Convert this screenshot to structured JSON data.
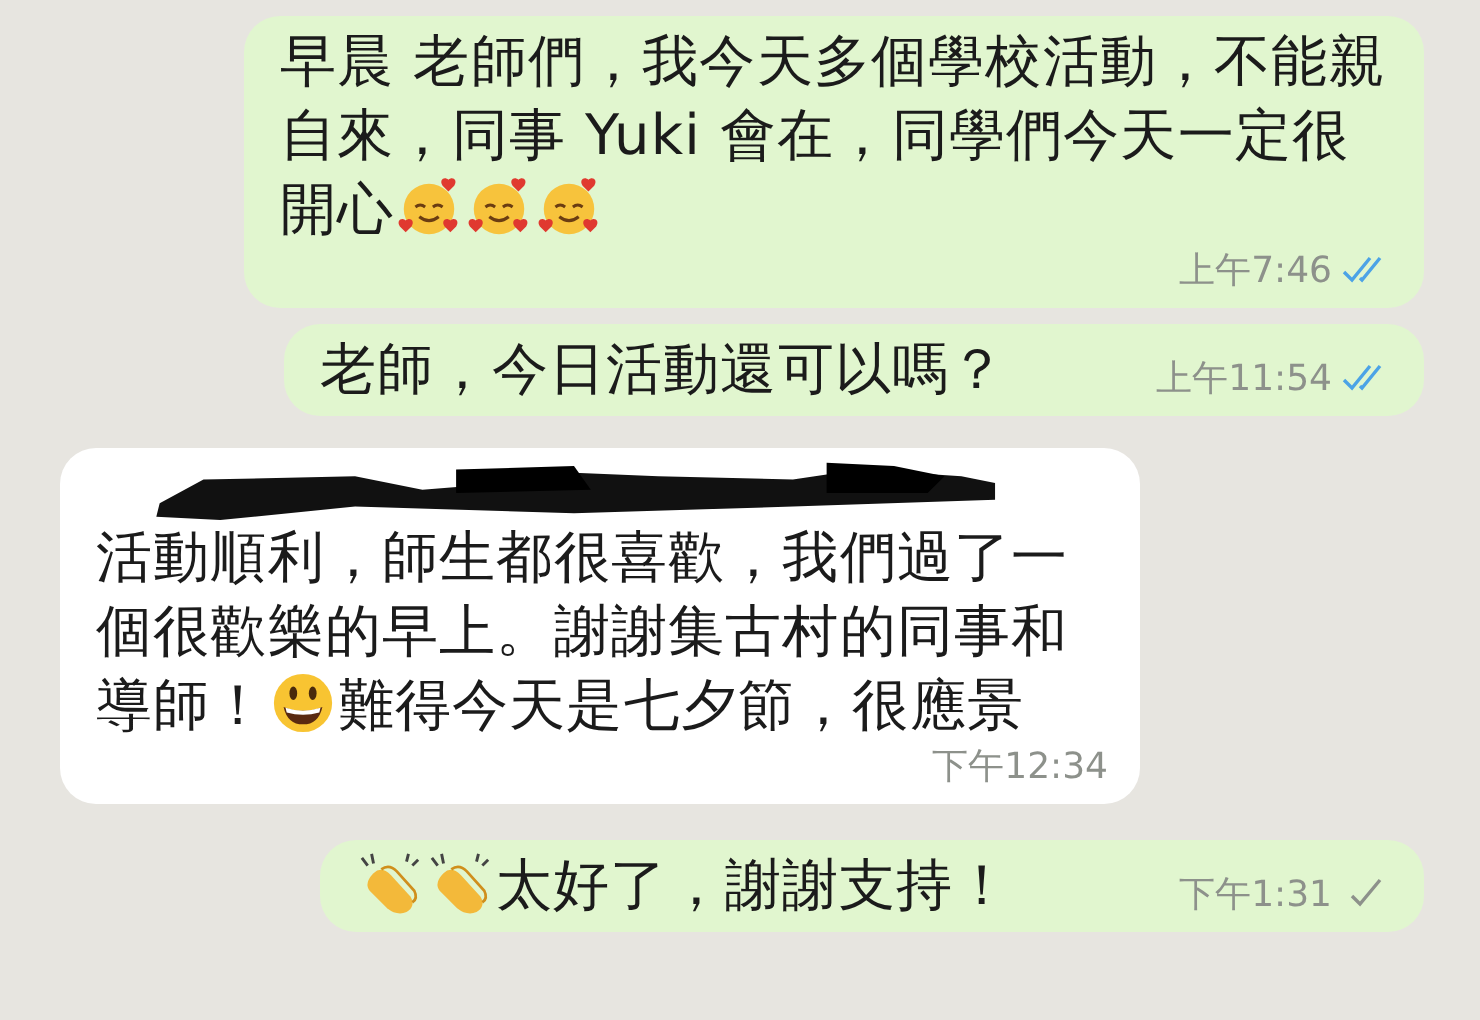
{
  "messages": [
    {
      "outgoing": true,
      "redacted": false,
      "parts": [
        {
          "kind": "text",
          "text": "早晨 老師們，我今天多個學校活動，不能親自來，同事 Yuki 會在，同學們今天一定很開心"
        },
        {
          "kind": "hearts"
        },
        {
          "kind": "hearts"
        },
        {
          "kind": "hearts"
        }
      ],
      "time": "上午7:46",
      "read": true
    },
    {
      "outgoing": true,
      "redacted": false,
      "parts": [
        {
          "kind": "text",
          "text": "老師，今日活動還可以嗎？"
        }
      ],
      "time": "上午11:54",
      "read": true
    },
    {
      "outgoing": false,
      "redacted": true,
      "parts": [
        {
          "kind": "text",
          "text": "活動順利，師生都很喜歡，我們過了一個很歡樂的早上。謝謝集古村的同事和導師！"
        },
        {
          "kind": "grin"
        },
        {
          "kind": "text",
          "text": "難得今天是七夕節，很應景"
        }
      ],
      "time": "下午12:34"
    },
    {
      "outgoing": true,
      "redacted": false,
      "parts": [
        {
          "kind": "clap"
        },
        {
          "kind": "clap"
        },
        {
          "kind": "text",
          "text": "太好了，謝謝支持！"
        }
      ],
      "time": "下午1:31",
      "read": false
    }
  ]
}
